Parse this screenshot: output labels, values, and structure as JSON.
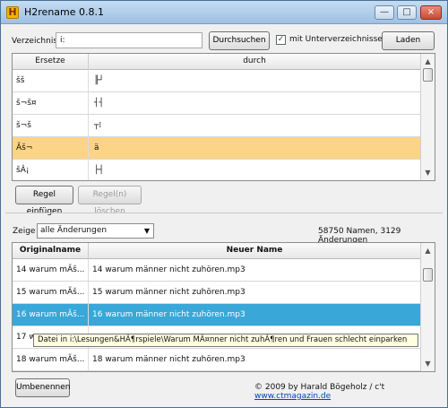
{
  "window": {
    "title": "H2rename 0.8.1",
    "app_icon": "H",
    "minimize_glyph": "—",
    "maximize_glyph": "□",
    "close_glyph": "×"
  },
  "directory": {
    "label": "Verzeichnis",
    "value": "i:",
    "browse_label": "Durchsuchen ...",
    "subdirs_checked": true,
    "subdirs_label": "mit Unterverzeichnissen",
    "load_label": "Laden"
  },
  "rules": {
    "headers": [
      "Ersetze",
      "durch"
    ],
    "rows": [
      {
        "from": "šš",
        "to": "╟┘"
      },
      {
        "from": "š¬š¤",
        "to": "┤┤"
      },
      {
        "from": "š¬š",
        "to": "┬⁞"
      },
      {
        "from": "Ãš¬",
        "to": "ä"
      },
      {
        "from": "šÂ¡",
        "to": "├┤"
      }
    ],
    "add_label": "Regel einfügen",
    "delete_label": "Regel(n) löschen"
  },
  "filter": {
    "label": "Zeige",
    "selected": "alle Änderungen",
    "summary": "58750 Namen, 3129 Änderungen"
  },
  "files": {
    "headers": [
      "Originalname",
      "Neuer Name"
    ],
    "rows": [
      {
        "original": "14 warum mÃš...",
        "new": "14 warum männer nicht zuhören.mp3"
      },
      {
        "original": "15 warum mÃš...",
        "new": "15 warum männer nicht zuhören.mp3"
      },
      {
        "original": "16 warum mÃš...",
        "new": "16 warum männer nicht zuhören.mp3"
      },
      {
        "original": "17 w",
        "new": ""
      },
      {
        "original": "18 warum mÃš...",
        "new": "18 warum männer nicht zuhören.mp3"
      }
    ],
    "tooltip": "Datei in i:\\Lesungen&HÃ¶rspiele\\Warum MÃ¤nner nicht zuhÃ¶ren und Frauen schlecht einparken"
  },
  "footer": {
    "rename_label": "Umbenennen",
    "copyright": "© 2009 by Harald Bögeholz / c't",
    "link": "www.ctmagazin.de"
  },
  "colors": {
    "rule_highlight": "#fbd487",
    "file_selection": "#39a7d8",
    "window_border": "#4a6f95"
  }
}
